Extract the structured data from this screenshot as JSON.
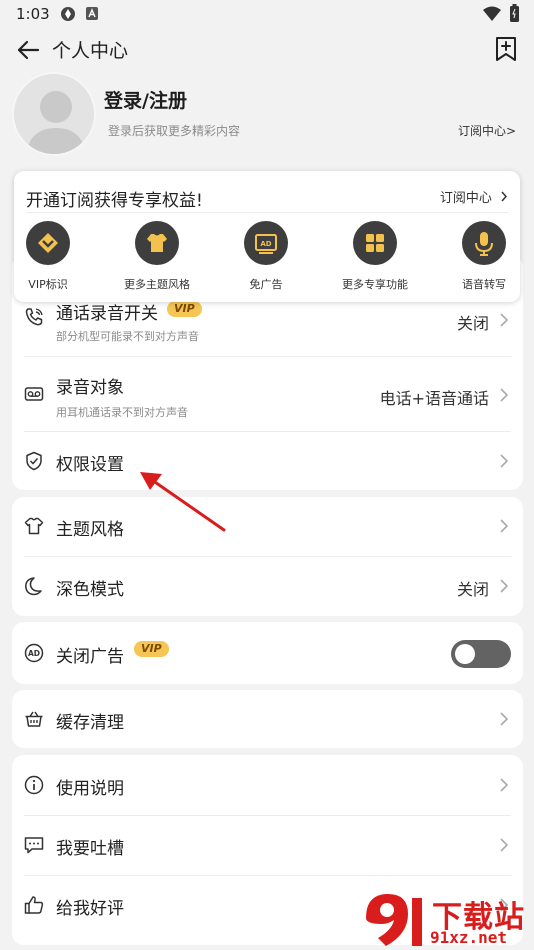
{
  "status_bar": {
    "time": "1:03"
  },
  "header": {
    "title": "个人中心"
  },
  "profile": {
    "login_title": "登录/注册",
    "login_subtitle": "登录后获取更多精彩内容",
    "subscription_link": "订阅中心>"
  },
  "promo": {
    "title": "开通订阅获得专享权益!",
    "link": "订阅中心",
    "features": [
      {
        "label": "VIP标识",
        "icon": "vip-badge-icon"
      },
      {
        "label": "更多主题风格",
        "icon": "shirt-icon"
      },
      {
        "label": "免广告",
        "icon": "ad-icon"
      },
      {
        "label": "更多专享功能",
        "icon": "grid-icon"
      },
      {
        "label": "语音转写",
        "icon": "microphone-icon"
      }
    ]
  },
  "settings": {
    "call_recording": {
      "label": "通话录音开关",
      "sub": "部分机型可能录不到对方声音",
      "value": "关闭",
      "badge": "VIP"
    },
    "record_target": {
      "label": "录音对象",
      "sub": "用耳机通话录不到对方声音",
      "value": "电话+语音通话"
    },
    "permissions": {
      "label": "权限设置"
    },
    "theme": {
      "label": "主题风格"
    },
    "dark_mode": {
      "label": "深色模式",
      "value": "关闭"
    },
    "close_ads": {
      "label": "关闭广告",
      "badge": "VIP",
      "toggle_on": false
    },
    "clear_cache": {
      "label": "缓存清理"
    },
    "help": {
      "label": "使用说明"
    },
    "feedback": {
      "label": "我要吐槽"
    },
    "rate": {
      "label": "给我好评"
    }
  },
  "watermark": {
    "text": "下载站",
    "url": "91xz.net"
  },
  "colors": {
    "accent_vip": "#f6c654",
    "arrow": "#d91c1c",
    "background": "#f2f2f2"
  }
}
